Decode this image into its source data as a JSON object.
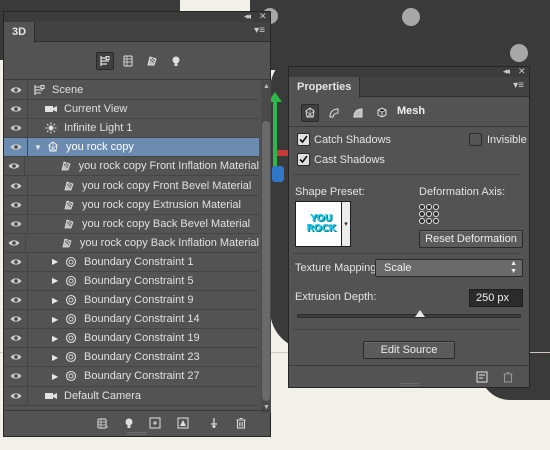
{
  "panel_3d": {
    "tab_label": "3D",
    "collapse_ctl": "◂◂",
    "close_ctl": "✕",
    "menu_ctl": "▾≡",
    "toolbar_icons": [
      "scene-filter-icon",
      "mesh-filter-icon",
      "material-filter-icon",
      "light-filter-icon"
    ],
    "rows": [
      {
        "label": "Scene",
        "icon": "scene-icon",
        "indent": 0,
        "expand": "",
        "selected": false
      },
      {
        "label": "Current View",
        "icon": "camera-icon",
        "indent": 1,
        "expand": "",
        "selected": false
      },
      {
        "label": "Infinite Light 1",
        "icon": "sun-icon",
        "indent": 1,
        "expand": "",
        "selected": false
      },
      {
        "label": "you rock copy",
        "icon": "mesh-icon",
        "indent": 1,
        "expand": "▼",
        "selected": true
      },
      {
        "label": "you rock copy Front Inflation Material",
        "icon": "material-icon",
        "indent": 2,
        "expand": "",
        "selected": false
      },
      {
        "label": "you rock copy Front Bevel Material",
        "icon": "material-icon",
        "indent": 2,
        "expand": "",
        "selected": false
      },
      {
        "label": "you rock copy Extrusion Material",
        "icon": "material-icon",
        "indent": 2,
        "expand": "",
        "selected": false
      },
      {
        "label": "you rock copy Back Bevel Material",
        "icon": "material-icon",
        "indent": 2,
        "expand": "",
        "selected": false
      },
      {
        "label": "you rock copy Back Inflation Material",
        "icon": "material-icon",
        "indent": 2,
        "expand": "",
        "selected": false
      },
      {
        "label": "Boundary Constraint 1",
        "icon": "constraint-icon",
        "indent": 2,
        "expand": "▶",
        "selected": false
      },
      {
        "label": "Boundary Constraint 5",
        "icon": "constraint-icon",
        "indent": 2,
        "expand": "▶",
        "selected": false
      },
      {
        "label": "Boundary Constraint 9",
        "icon": "constraint-icon",
        "indent": 2,
        "expand": "▶",
        "selected": false
      },
      {
        "label": "Boundary Constraint 14",
        "icon": "constraint-icon",
        "indent": 2,
        "expand": "▶",
        "selected": false
      },
      {
        "label": "Boundary Constraint 19",
        "icon": "constraint-icon",
        "indent": 2,
        "expand": "▶",
        "selected": false
      },
      {
        "label": "Boundary Constraint 23",
        "icon": "constraint-icon",
        "indent": 2,
        "expand": "▶",
        "selected": false
      },
      {
        "label": "Boundary Constraint 27",
        "icon": "constraint-icon",
        "indent": 2,
        "expand": "▶",
        "selected": false
      },
      {
        "label": "Default Camera",
        "icon": "camera-icon",
        "indent": 1,
        "expand": "",
        "selected": false
      }
    ],
    "bottom_icons": [
      "render-settings-icon",
      "add-light-icon",
      "new-mesh-icon",
      "constraint-add-icon",
      "render-icon",
      "trash-icon"
    ]
  },
  "properties": {
    "tab_label": "Properties",
    "collapse_ctl": "◂◂",
    "close_ctl": "✕",
    "menu_ctl": "▾≡",
    "mode_label": "Mesh",
    "catch_shadows": "Catch Shadows",
    "cast_shadows": "Cast Shadows",
    "invisible": "Invisible",
    "shape_preset_label": "Shape Preset:",
    "preset_thumb_line1": "YOU",
    "preset_thumb_line2": "ROCK",
    "deformation_axis_label": "Deformation Axis:",
    "reset_deformation": "Reset Deformation",
    "texture_mapping_label": "Texture Mapping:",
    "texture_mapping_value": "Scale",
    "extrusion_depth_label": "Extrusion Depth:",
    "extrusion_depth_value": "250 px",
    "extrusion_slider_fraction": 0.55,
    "edit_source": "Edit Source"
  },
  "colors": {
    "panel_bg": "#535353",
    "selected_row": "#6c8bb0",
    "gizmo_green": "#2db84c",
    "preset_cyan": "#19c7e6"
  }
}
